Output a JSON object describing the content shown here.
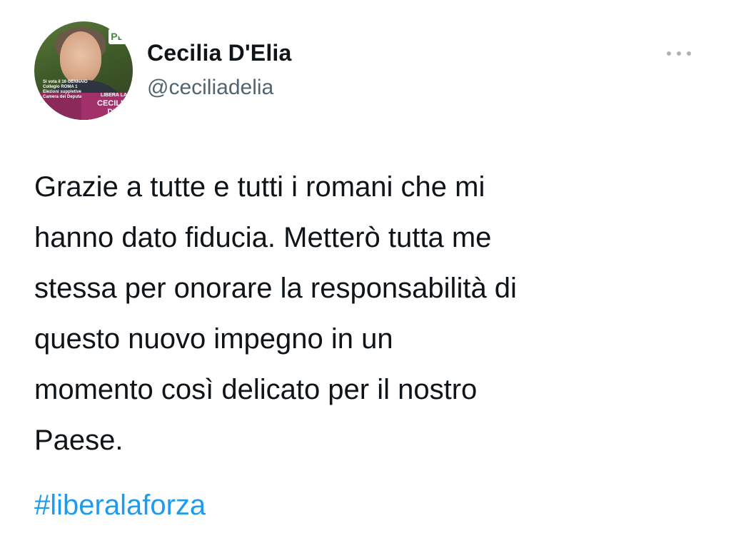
{
  "author": {
    "display_name": "Cecilia D'Elia",
    "handle": "@ceciliadelia",
    "avatar": {
      "banner_lines": [
        "Si vota il 16 GENNAIO",
        "Collegio ROMA 1",
        "Elezioni suppletive",
        "Camera dei Deputati"
      ],
      "badge_lines": [
        "LIBERA LA",
        "CECILIA",
        "D'ELI"
      ],
      "logo_text": "PD"
    }
  },
  "menu": {
    "icon": "more-horizontal-icon"
  },
  "tweet": {
    "text_lines": [
      "Grazie a tutte e tutti i romani che mi",
      "hanno dato fiducia. Metterò tutta me",
      "stessa per onorare la responsabilità di",
      "questo nuovo impegno in un",
      "momento così delicato per il nostro",
      "Paese."
    ],
    "hashtag": "#liberalaforza"
  },
  "colors": {
    "text": "#0f1419",
    "secondary_text": "#536471",
    "link": "#1d9bf0",
    "menu_dots": "#a9b4bd"
  }
}
